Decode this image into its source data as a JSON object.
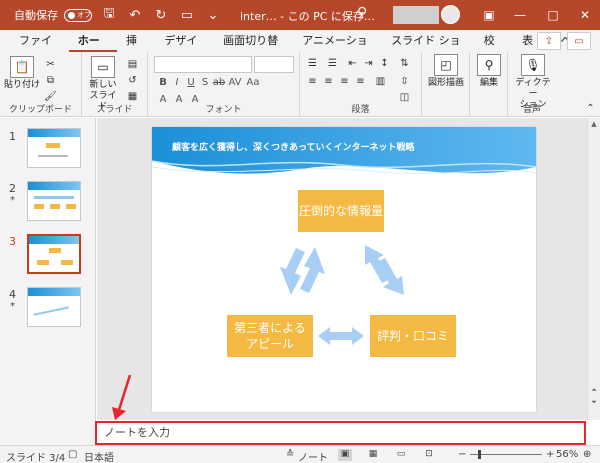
{
  "titlebar": {
    "autosave_label": "自動保存",
    "autosave_state": "オフ",
    "doc_title": "inter… - この PC に保存…",
    "accent": "#b7472a"
  },
  "tabs": [
    "ファイル",
    "ホーム",
    "挿入",
    "デザイン",
    "画面切り替え",
    "アニメーション",
    "スライド ショー",
    "校閲",
    "表示",
    "ヘルプ"
  ],
  "active_tab": "ホーム",
  "ribbon": {
    "clipboard": {
      "paste": "貼り付け",
      "label": "クリップボード"
    },
    "slides": {
      "new_slide_line1": "新しい",
      "new_slide_line2": "スライド",
      "label": "スライド"
    },
    "font": {
      "label": "フォント",
      "case_btn": "Aa"
    },
    "paragraph": {
      "label": "段落"
    },
    "drawing": {
      "label": "図形描画"
    },
    "editing": {
      "label": "編集"
    },
    "voice": {
      "dictate_line1": "ディクテー",
      "dictate_line2": "ション",
      "label": "音声"
    }
  },
  "thumbnails": [
    {
      "num": "1",
      "star": ""
    },
    {
      "num": "2",
      "star": "*"
    },
    {
      "num": "3",
      "star": ""
    },
    {
      "num": "4",
      "star": "*"
    }
  ],
  "selected_slide": "3",
  "slide": {
    "title": "顧客を広く獲得し、深くつきあっていくインターネット戦略",
    "box_top": "圧倒的な情報量",
    "box_left": "第三者による\nアピール",
    "box_right": "評判・口コミ",
    "box_color": "#f4b942",
    "arrow_color": "#a8cff3"
  },
  "notes_placeholder": "ノートを入力",
  "status": {
    "slide_count": "スライド 3/4",
    "language": "日本語",
    "notes": "ノート",
    "zoom": "56%"
  }
}
